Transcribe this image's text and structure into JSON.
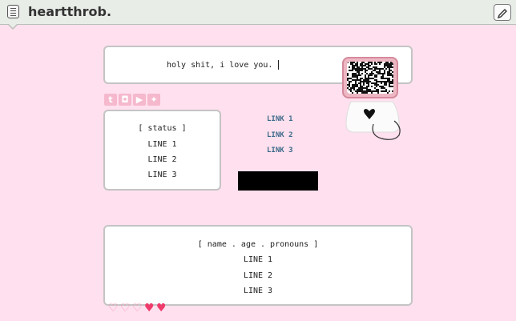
{
  "header": {
    "title": "heartthrob."
  },
  "quote": {
    "text": "holy shit, i love you."
  },
  "status_box": {
    "heading": "[ status ]",
    "lines": [
      "LINE 1",
      "LINE 2",
      "LINE 3"
    ]
  },
  "links": [
    "LINK 1",
    "LINK 2",
    "LINK 3"
  ],
  "social": {
    "items": [
      "tumblr-icon",
      "instagram-icon",
      "youtube-icon",
      "twitter-icon"
    ],
    "glyphs": [
      "t",
      "◘",
      "▶",
      "✦"
    ]
  },
  "profile_box": {
    "heading": "[ name . age . pronouns ]",
    "lines": [
      "LINE 1",
      "LINE 2",
      "LINE 3"
    ]
  },
  "colors": {
    "background": "#ffe0ee",
    "social": "#f5b8cd",
    "link": "#3b6a8a",
    "hearts_empty": "#f48aaa",
    "hearts_full": "#ef3b6b"
  },
  "hearts": {
    "filled": 2,
    "total": 5
  }
}
